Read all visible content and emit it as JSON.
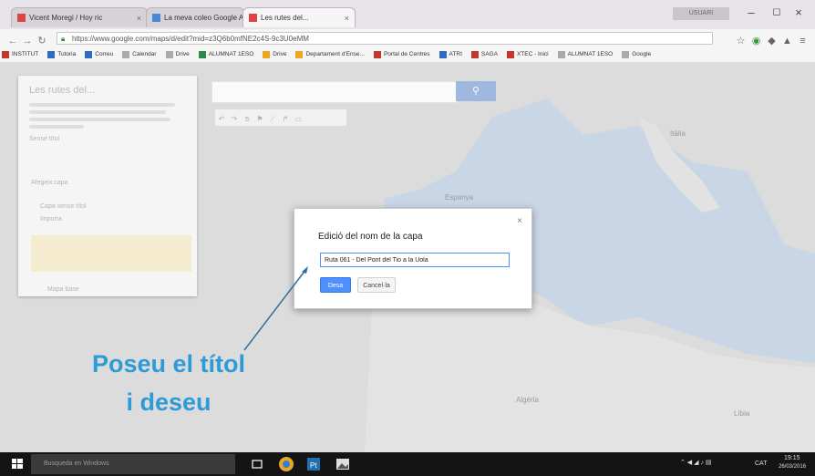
{
  "browser": {
    "tabs": [
      {
        "label": "Vicent Moregi / Hoy ric",
        "active": false
      },
      {
        "label": "La meva coleo Google A",
        "active": false
      },
      {
        "label": "Les rutes del...",
        "active": true
      }
    ],
    "user_chip": "USUARI",
    "address": "https://www.google.com/maps/d/edit?mid=z3Q6b0mfNE2c4S-9c3U0eMM",
    "bookmarks": [
      {
        "label": "INSTITUT",
        "color": "#c0392b"
      },
      {
        "label": "Tutoria",
        "color": "#2d6cc0"
      },
      {
        "label": "Correu",
        "color": "#2d6cc0"
      },
      {
        "label": "Calendar",
        "color": "#aaaaaa"
      },
      {
        "label": "Drive",
        "color": "#aaaaaa"
      },
      {
        "label": "ALUMNAT 1ESO",
        "color": "#2a8a4a"
      },
      {
        "label": "Drive",
        "color": "#e8a824"
      },
      {
        "label": "Departament d'Ense...",
        "color": "#e8a824"
      },
      {
        "label": "Portal de Centres",
        "color": "#c0392b"
      },
      {
        "label": "ATRI",
        "color": "#2d6cc0"
      },
      {
        "label": "SAGA",
        "color": "#c0392b"
      },
      {
        "label": "XTEC - Inici",
        "color": "#c0392b"
      },
      {
        "label": "ALUMNAT 1ESO",
        "color": "#aaaaaa"
      },
      {
        "label": "Google",
        "color": "#aaaaaa"
      }
    ]
  },
  "panel": {
    "title": "Les rutes del...",
    "updated": "Sense títol",
    "layer_link": "Afegeix capa",
    "layer_name": "Capa sense títol",
    "layer_sub": "Importa",
    "base_map": "Mapa base"
  },
  "map_labels": {
    "italy": "Itàlia",
    "spain": "Espanya",
    "algeria": "Algèria",
    "libya": "Líbia"
  },
  "dialog": {
    "title": "Edició del nom de la capa",
    "input_value": "Ruta 061 - Del Pont del Tio a la Uola",
    "save": "Desa",
    "cancel": "Cancel·la",
    "close": "×"
  },
  "annotation": {
    "line1": "Poseu el títol",
    "line2": "i deseu",
    "color": "#2e9bd6"
  },
  "taskbar": {
    "search_placeholder": "Busqueda en Windows",
    "lang": "CAT",
    "time": "19:15",
    "date": "26/03/2016"
  }
}
